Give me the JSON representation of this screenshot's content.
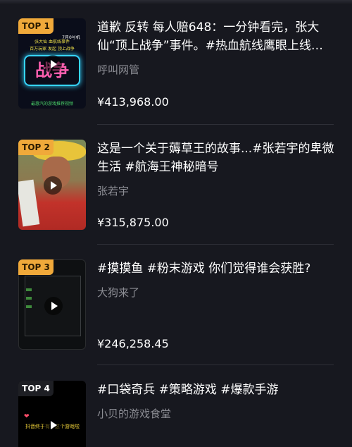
{
  "items": [
    {
      "rank": "TOP 1",
      "title": "道歉 反转 每人赔648：一分钟看完，张大仙“顶上战争”事件。#热血航线鹰眼上线…",
      "author": "呼叫网管",
      "amount": "¥413,968.00",
      "thumb_text": {
        "line1": "张大仙 血航线事件",
        "line2": "百万玩家 发起 顶上战争",
        "line3": "7月0号机",
        "neon": "战争",
        "bottom": "最惠汽的游戏推荐视频"
      }
    },
    {
      "rank": "TOP 2",
      "title": "这是一个关于薅草王的故事...#张若宇的卑微生活 #航海王神秘暗号",
      "author": "张若宇",
      "amount": "¥315,875.00"
    },
    {
      "rank": "TOP 3",
      "title": "#摸摸鱼 #粉末游戏 你们觉得谁会获胜?",
      "author": "大狗来了",
      "amount": "¥246,258.45"
    },
    {
      "rank": "TOP 4",
      "title": "#口袋奇兵 #策略游戏 #爆款手游",
      "author": "小贝的游戏食堂",
      "thumb_text": {
        "caption": "抖音终于有了这个游戏啦"
      }
    }
  ],
  "colors": {
    "background": "#17181f",
    "badge": "#f0a93a",
    "secondary_text": "#8c8d94"
  }
}
